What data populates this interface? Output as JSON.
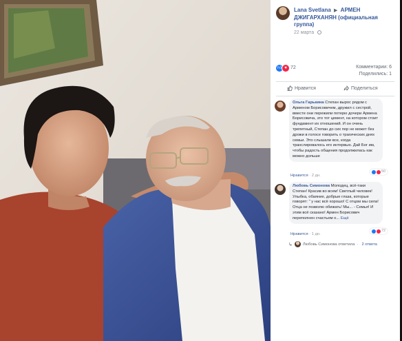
{
  "post": {
    "author": "Lana Svetlana",
    "group": "АРМЕН ДЖИГАРХАНЯН (официальная группа)",
    "time": "22 марта",
    "reaction_count": "72",
    "comments_count": "Комментарии: 6",
    "shares_count": "Поделились: 1"
  },
  "actions": {
    "like": "Нравится",
    "share": "Поделиться"
  },
  "comments": [
    {
      "author": "Ольга Гарькина",
      "text": "Степан вырос рядом с Арменом Борисовичем, дружил с сестрой, вместе они пережили потерю дочери Армена Борисовича, это тот цемент, на котором стоит фундамент их отношений. И он очень трепетный, Степан до сих пор не может без дрожи в голосе говорить о трагических днях семьи. Это слышали все, когда транслировалось его интервью. Дай Бог им, чтобы радость общения продолжилась как можно дольше",
      "reactions": "50",
      "reply_label": "Нравится",
      "age": "2 дн."
    },
    {
      "author": "Любовь Симонова",
      "text": "Молодец, всё-таки Степан! Красив во всем! Светлый человек! Улыбка, обаяние, добрые глаза, которые говорят: \" у нас всё хорошо! С отцом мы сила! Отца не позволю обижать! Мы... - Семья! И этим всё сказано! Армен Борисович переполнен счастьем о...",
      "more": "Ещё",
      "reactions": "72",
      "reply_label": "Нравится",
      "age": "1 дн."
    }
  ],
  "reply_row": {
    "text": "Любовь Симонова ответила",
    "separator": "·",
    "count": "2 ответа"
  },
  "colors": {
    "link": "#385898",
    "like_blue": "#2078f4",
    "love_red": "#f0284a"
  }
}
